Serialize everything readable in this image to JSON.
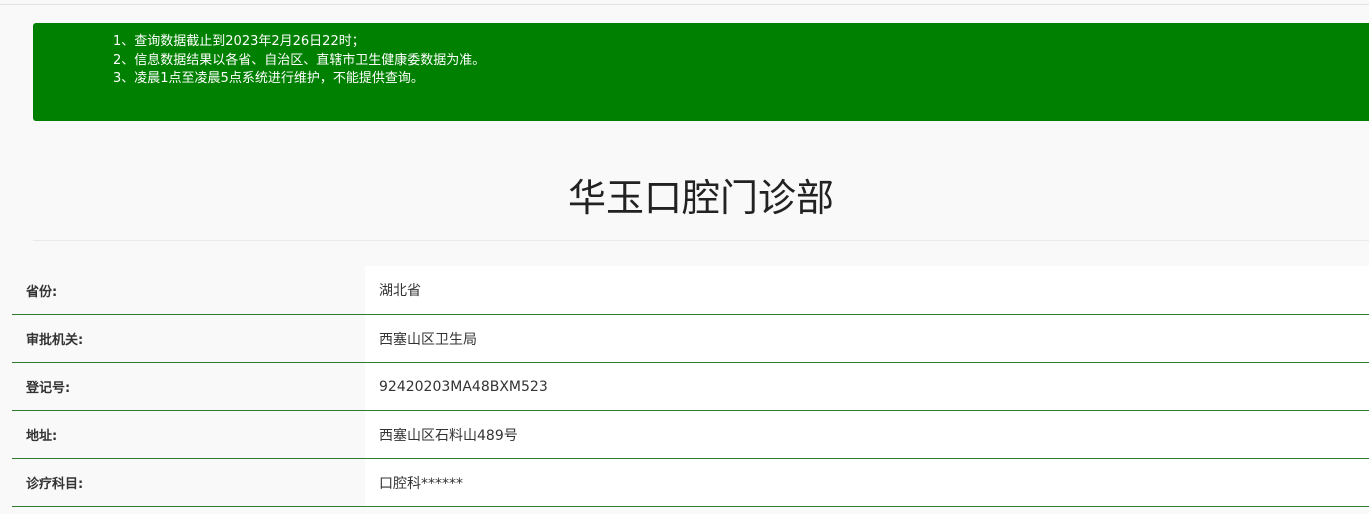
{
  "notice": {
    "lines": [
      "1、查询数据截止到2023年2月26日22时；",
      "2、信息数据结果以各省、自治区、直辖市卫生健康委数据为准。",
      "3、凌晨1点至凌晨5点系统进行维护，不能提供查询。"
    ]
  },
  "title": "华玉口腔门诊部",
  "info": [
    {
      "label": "省份:",
      "value": "湖北省"
    },
    {
      "label": "审批机关:",
      "value": "西塞山区卫生局"
    },
    {
      "label": "登记号:",
      "value": "92420203MA48BXM523"
    },
    {
      "label": "地址:",
      "value": "西塞山区石料山489号"
    },
    {
      "label": "诊疗科目:",
      "value": "口腔科******"
    }
  ],
  "colors": {
    "notice_bg": "#008000",
    "row_rule": "#2e7d32"
  }
}
